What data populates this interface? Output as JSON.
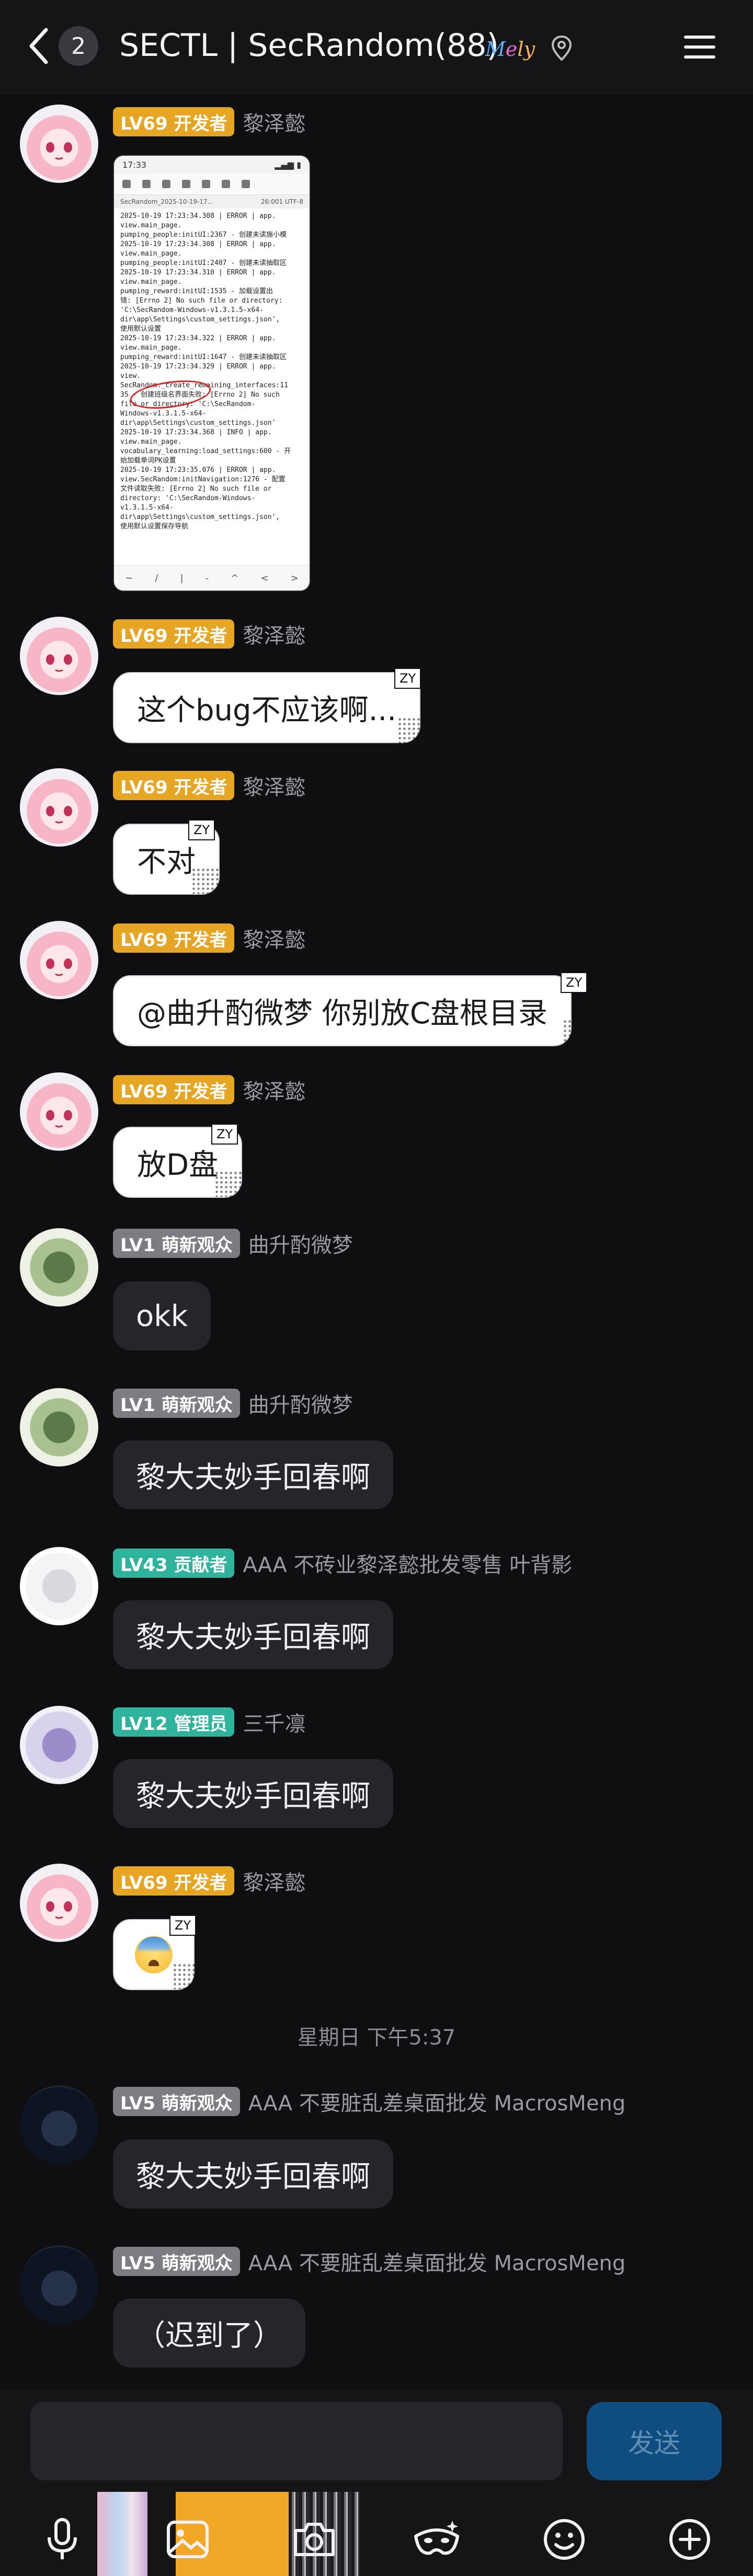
{
  "header": {
    "back_icon": "chevron-left-icon",
    "unread_count": "2",
    "title": "SECTL | SecRandom(88)",
    "badge_text": [
      "M",
      "e",
      "ly"
    ],
    "menu_icon": "hamburger-menu-icon"
  },
  "messages": [
    {
      "badge": "LV69 开发者",
      "sender": "黎泽懿",
      "screenshot": {
        "time": "17:33",
        "tab_left": "SecRandom_2025-10-19-17...",
        "tab_right": "26:001  UTF-8",
        "log_lines": [
          "2025-10-19 17:23:34.308 | ERROR | app.",
          "view.main_page.",
          "pumping_people:initUI:2367 - 创建未读施小模",
          "2025-10-19 17:23:34.308 | ERROR | app.",
          "view.main_page.",
          "pumping_people:initUI:2407 - 创建未读抽取区",
          "2025-10-19 17:23:34.310 | ERROR | app.",
          "view.main_page.",
          "pumping_reward:initUI:1535 - 加载设置出",
          "错: [Errno 2] No such file or directory:",
          "'C:\\SecRandom-Windows-v1.3.1.5-x64-",
          "dir\\app\\Settings\\custom_settings.json',",
          "使用默认设置",
          "2025-10-19 17:23:34.322 | ERROR | app.",
          "view.main_page.",
          "pumping_reward:initUI:1647 - 创建未读抽取区",
          "2025-10-19 17:23:34.329 | ERROR | app.",
          "view.",
          "SecRandom:_create_remaining_interfaces:11",
          "35 - 创建班级名界面失败: [Errno 2] No such",
          "file or directory: 'C:\\SecRandom-",
          "Windows-v1.3.1.5-x64-",
          "dir\\app\\Settings\\custom_settings.json'",
          "2025-10-19 17:23:34.368 | INFO | app.",
          "view.main_page.",
          "vocabulary_learning:load_settings:600 - 开",
          "始加载单词PK设置",
          "2025-10-19 17:23:35.076 | ERROR | app.",
          "view.SecRandom:initNavigation:1276 - 配置",
          "文件读取失败: [Errno 2] No such file or",
          "directory: 'C:\\SecRandom-Windows-",
          "v1.3.1.5-x64-",
          "dir\\app\\Settings\\custom_settings.json',",
          "使用默认设置保存导航"
        ],
        "bottom_keys": [
          "~",
          "/",
          "|",
          "-",
          "^",
          "<",
          ">"
        ]
      }
    },
    {
      "badge": "LV69 开发者",
      "sender": "黎泽懿",
      "text": "这个bug不应该啊...",
      "tag": "ZY"
    },
    {
      "badge": "LV69 开发者",
      "sender": "黎泽懿",
      "text": "不对",
      "tag": "ZY"
    },
    {
      "badge": "LV69 开发者",
      "sender": "黎泽懿",
      "text": "@曲升酌微梦 你别放C盘根目录",
      "tag": "ZY"
    },
    {
      "badge": "LV69 开发者",
      "sender": "黎泽懿",
      "text": "放D盘",
      "tag": "ZY"
    },
    {
      "badge": "LV1 萌新观众",
      "sender": "曲升酌微梦",
      "text": "okk"
    },
    {
      "badge": "LV1 萌新观众",
      "sender": "曲升酌微梦",
      "text": "黎大夫妙手回春啊"
    },
    {
      "badge": "LV43 贡献者",
      "sender": "AAA 不砖业黎泽懿批发零售 叶背影",
      "text": "黎大夫妙手回春啊"
    },
    {
      "badge": "LV12 管理员",
      "sender": "三千凛",
      "text": "黎大夫妙手回春啊"
    },
    {
      "badge": "LV69 开发者",
      "sender": "黎泽懿",
      "emoji": "anxious-sweat-emoji",
      "tag": "ZY"
    },
    {
      "badge": "LV5 萌新观众",
      "sender": "AAA 不要脏乱差桌面批发 MacrosMeng",
      "text": "黎大夫妙手回春啊"
    },
    {
      "badge": "LV5 萌新观众",
      "sender": "AAA 不要脏乱差桌面批发 MacrosMeng",
      "text": "（迟到了）"
    }
  ],
  "timestamp": "星期日 下午5:37",
  "composer": {
    "input_value": "",
    "send_label": "发送",
    "tools": [
      "microphone-icon",
      "image-icon",
      "camera-icon",
      "mask-sparkle-icon",
      "smiley-icon",
      "plus-circle-icon"
    ]
  },
  "colors": {
    "background": "#0f0f11",
    "dev_badge": "#e6a523",
    "newbie_badge": "#7c7c82",
    "contributor_badge": "#2fb39d",
    "send_button": "#0f4d80"
  }
}
